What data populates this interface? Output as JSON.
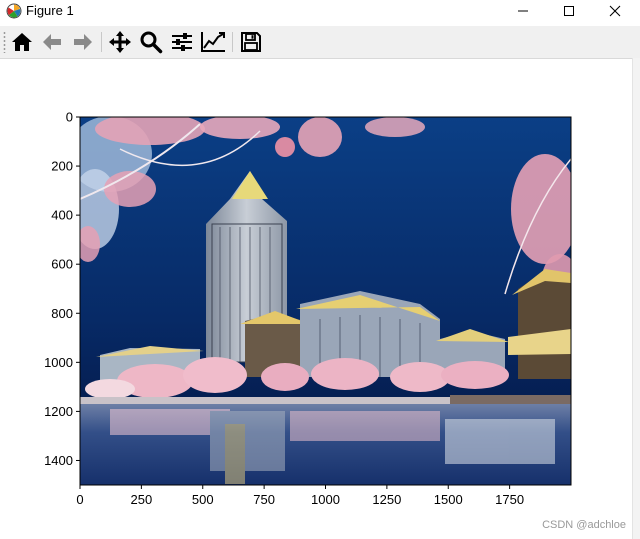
{
  "window": {
    "title": "Figure 1",
    "app_icon": "matplotlib-icon"
  },
  "toolbar": {
    "buttons": [
      {
        "name": "home-button",
        "icon": "home-icon",
        "tooltip": "Home"
      },
      {
        "name": "back-button",
        "icon": "arrow-left-icon",
        "tooltip": "Back"
      },
      {
        "name": "forward-button",
        "icon": "arrow-right-icon",
        "tooltip": "Forward"
      },
      {
        "name": "pan-button",
        "icon": "move-icon",
        "tooltip": "Pan"
      },
      {
        "name": "zoom-button",
        "icon": "magnifier-icon",
        "tooltip": "Zoom"
      },
      {
        "name": "subplots-button",
        "icon": "sliders-icon",
        "tooltip": "Subplots"
      },
      {
        "name": "axes-button",
        "icon": "line-chart-icon",
        "tooltip": "Customize"
      },
      {
        "name": "save-button",
        "icon": "floppy-disk-icon",
        "tooltip": "Save"
      }
    ]
  },
  "chart_data": {
    "type": "image",
    "image_extent": {
      "width": 2000,
      "height": 1500
    },
    "x_ticks": [
      0,
      250,
      500,
      750,
      1000,
      1250,
      1500,
      1750
    ],
    "y_ticks": [
      0,
      200,
      400,
      600,
      800,
      1000,
      1200,
      1400
    ],
    "xlim": [
      0,
      2000
    ],
    "ylim": [
      1500,
      0
    ],
    "y_axis_inverted": true,
    "title": "",
    "xlabel": "",
    "ylabel": "",
    "image_content": "color-inverted photo",
    "colors": {
      "sky_top": "#0b3f86",
      "sky_bottom": "#03123d",
      "water": "#1b3a78",
      "blossom": "#e8a2b4"
    }
  },
  "watermark": "CSDN @adchloe"
}
